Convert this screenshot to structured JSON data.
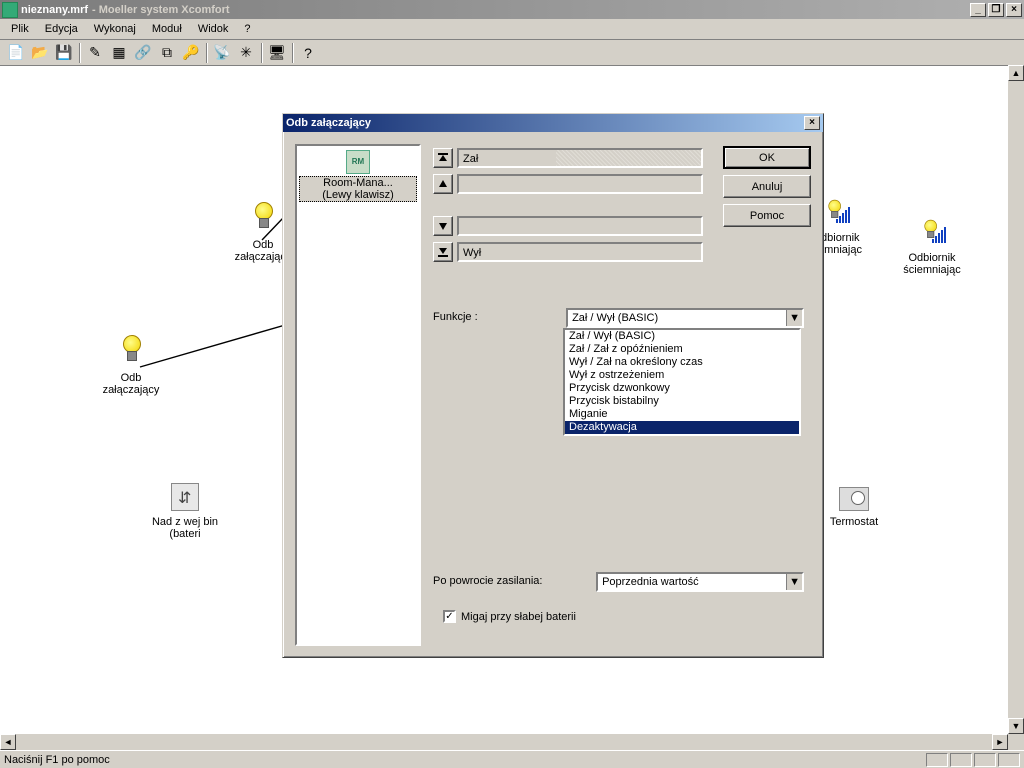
{
  "titlebar": {
    "filename": "nieznany.mrf",
    "appname": "Moeller system Xcomfort"
  },
  "menu": {
    "items": [
      "Plik",
      "Edycja",
      "Wykonaj",
      "Moduł",
      "Widok",
      "?"
    ]
  },
  "statusbar": {
    "hint": "Naciśnij F1 po pomoc"
  },
  "devices": {
    "odb1": {
      "line1": "Odb",
      "line2": "załączający"
    },
    "odb2": {
      "line1": "Odb",
      "line2": "załączający"
    },
    "nad": {
      "line1": "Nad z wej bin",
      "line2": "(bateri"
    },
    "dim1": {
      "line1": "Odbiornik",
      "line2": "ciemniając"
    },
    "dim2": {
      "line1": "Odbiornik",
      "line2": "ściemniając"
    },
    "therm": {
      "line1": "Termostat"
    }
  },
  "dialog": {
    "title": "Odb załączający",
    "list_item": {
      "line1": "Room-Mana...",
      "line2": "(Lewy klawisz)",
      "iconLabel": "RM"
    },
    "buttons": {
      "ok": "OK",
      "cancel": "Anuluj",
      "help": "Pomoc"
    },
    "levels": {
      "r1": "Zał",
      "r2": "",
      "r3": "",
      "r4": "Wył"
    },
    "funkcje_label": "Funkcje :",
    "funkcje_combo": "Zał / Wył (BASIC)",
    "funkcje_options": [
      "Zał / Wył (BASIC)",
      "Zał / Zał z opóźnieniem",
      "Wył / Zał na określony czas",
      "Wył z ostrzeżeniem",
      "Przycisk dzwonkowy",
      "Przycisk bistabilny",
      "Miganie",
      "Dezaktywacja"
    ],
    "funkcje_selected_index": 7,
    "powr_label": "Po powrocie zasilania:",
    "powr_combo": "Poprzednia wartość",
    "migaj_label": "Migaj przy słabej baterii"
  }
}
